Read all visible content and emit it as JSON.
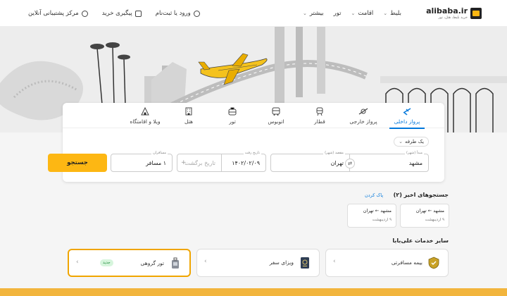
{
  "logo": {
    "name": "alibaba.ir",
    "tagline": "خرید بلیط، هتل، تور"
  },
  "nav": [
    {
      "label": "بلیط"
    },
    {
      "label": "اقامت"
    },
    {
      "label": "تور"
    },
    {
      "label": "بیشتر"
    }
  ],
  "top_links": {
    "support": "مرکز پشتیبانی آنلاین",
    "orders": "پیگیری خرید",
    "login": "ورود یا ثبت‌نام"
  },
  "tabs": [
    {
      "label": "پرواز داخلی",
      "icon": "domestic-flight-icon",
      "active": true
    },
    {
      "label": "پرواز خارجی",
      "icon": "international-flight-icon",
      "active": false
    },
    {
      "label": "قطار",
      "icon": "train-icon",
      "active": false
    },
    {
      "label": "اتوبوس",
      "icon": "bus-icon",
      "active": false
    },
    {
      "label": "تور",
      "icon": "tour-icon",
      "active": false
    },
    {
      "label": "هتل",
      "icon": "hotel-icon",
      "active": false
    },
    {
      "label": "ویلا و اقامتگاه",
      "icon": "villa-icon",
      "active": false
    }
  ],
  "search": {
    "trip_type": "یک طرفه",
    "origin_label": "مبدأ (شهر)",
    "origin_value": "مشهد",
    "dest_label": "مقصد (شهر)",
    "dest_value": "تهران",
    "depart_label": "تاریخ رفت",
    "depart_value": "۱۴۰۲/۰۲/۰۹",
    "return_placeholder": "تاریخ برگشت",
    "pax_label": "مسافران",
    "pax_value": "۱ مسافر",
    "button": "جستجو"
  },
  "recent": {
    "title": "جستجوهای اخیر (۲)",
    "clear": "پاک کردن",
    "items": [
      {
        "route": "مشهد ← تهران",
        "date": "۹ اردیبهشت"
      },
      {
        "route": "مشهد ← تهران",
        "date": "۹ اردیبهشت"
      }
    ]
  },
  "services": {
    "title": "سایر خدمات علی‌بابا",
    "items": [
      {
        "label": "بیمه مسافرتی",
        "icon": "insurance-shield-icon"
      },
      {
        "label": "ویزای سفر",
        "icon": "passport-icon"
      },
      {
        "label": "تور گروهی",
        "icon": "luggage-icon",
        "badge": "جدید"
      }
    ]
  },
  "colors": {
    "accent": "#fdb713",
    "link": "#0077db",
    "highlight": "#f0a500",
    "footer": "#f2b53d"
  }
}
